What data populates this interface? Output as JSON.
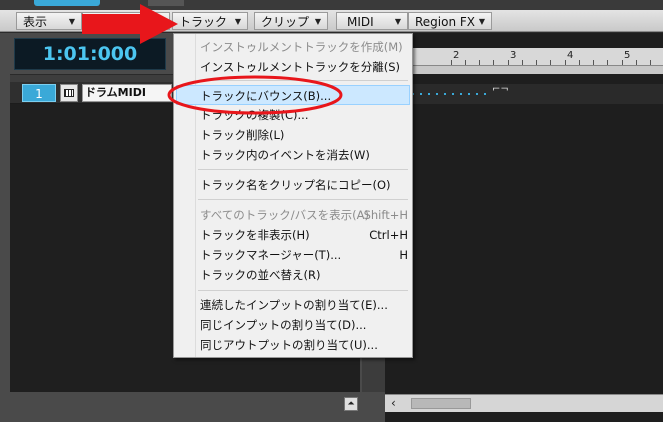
{
  "menubar": {
    "items": [
      {
        "label": "表示"
      },
      {
        "label": "トラック"
      },
      {
        "label": "クリップ"
      },
      {
        "label": "MIDI"
      },
      {
        "label": "Region FX"
      }
    ]
  },
  "transport": {
    "time": "1:01:000"
  },
  "track": {
    "number": "1",
    "name": "ドラムMIDI"
  },
  "ruler": {
    "marks": [
      "2",
      "3",
      "4",
      "5"
    ]
  },
  "track_menu": {
    "items": [
      {
        "label": "インストゥルメントトラックを作成(M)",
        "shortcut": "",
        "disabled": true
      },
      {
        "label": "インストゥルメントトラックを分離(S)",
        "shortcut": "",
        "disabled": false
      },
      {
        "label": "トラックにバウンス(B)...",
        "shortcut": "",
        "disabled": false
      },
      {
        "label": "トラックの複製(C)...",
        "shortcut": "",
        "disabled": false
      },
      {
        "label": "トラック削除(L)",
        "shortcut": "",
        "disabled": false
      },
      {
        "label": "トラック内のイベントを消去(W)",
        "shortcut": "",
        "disabled": false
      },
      {
        "label": "トラック名をクリップ名にコピー(O)",
        "shortcut": "",
        "disabled": false
      },
      {
        "label": "すべてのトラック/バスを表示(A)",
        "shortcut": "Shift+H",
        "disabled": true
      },
      {
        "label": "トラックを非表示(H)",
        "shortcut": "Ctrl+H",
        "disabled": false
      },
      {
        "label": "トラックマネージャー(T)...",
        "shortcut": "H",
        "disabled": false
      },
      {
        "label": "トラックの並べ替え(R)",
        "shortcut": "",
        "disabled": false
      },
      {
        "label": "連続したインプットの割り当て(E)...",
        "shortcut": "",
        "disabled": false
      },
      {
        "label": "同じインプットの割り当て(D)...",
        "shortcut": "",
        "disabled": false
      },
      {
        "label": "同じアウトプットの割り当て(U)...",
        "shortcut": "",
        "disabled": false
      }
    ]
  },
  "colors": {
    "accent": "#3aa9d8",
    "annotation": "#e8161b",
    "highlight": "#cce8ff"
  },
  "icons": [
    "piano-keys-icon",
    "scroll-up-icon",
    "scroll-left-icon",
    "clip-end-icon"
  ]
}
